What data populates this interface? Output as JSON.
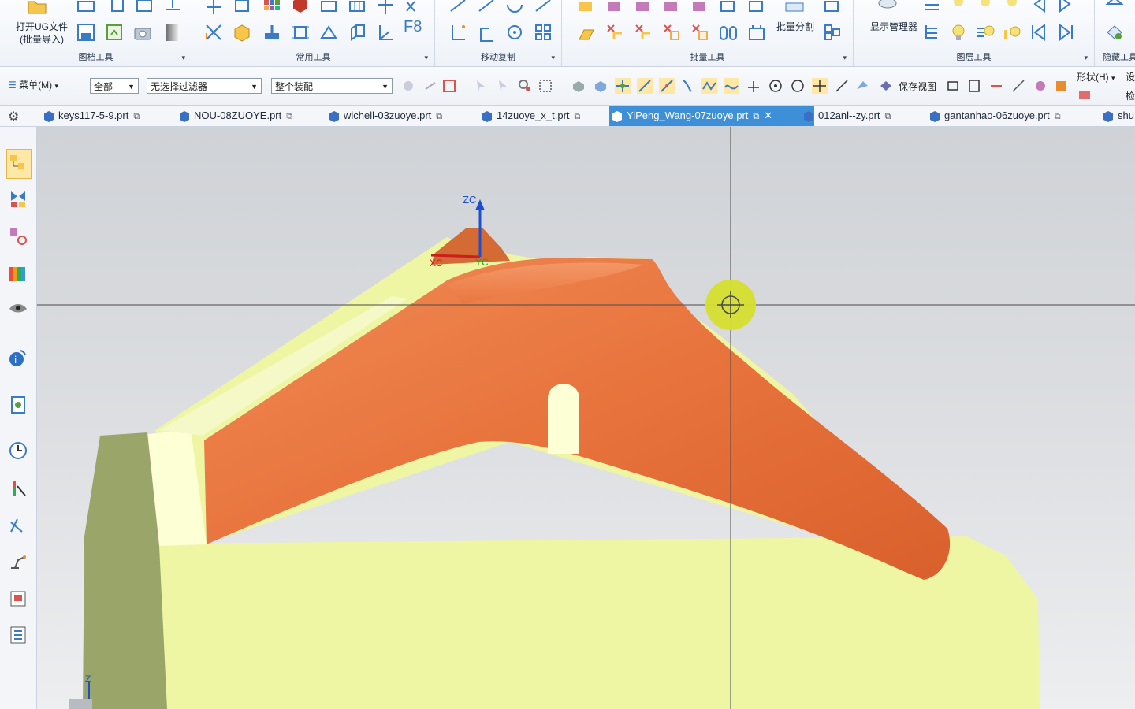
{
  "ribbon": {
    "open_ug": "打开UG文件",
    "batch_import": "(批量导入)",
    "groups": {
      "file_tools": "图档工具",
      "common_tools": "常用工具",
      "move_copy": "移动复制",
      "batch_tools": "批量工具",
      "layer_tools": "图层工具",
      "hide_tools": "隐藏工具"
    },
    "f8_label": "F8",
    "batch_split": "批量分割",
    "display_manager": "显示管理器"
  },
  "toolbar": {
    "menu_label": "菜单(M)",
    "filter_all": "全部",
    "no_filter": "无选择过滤器",
    "whole_assembly": "整个装配",
    "save_view": "保存视图",
    "shape_label": "形状(H)",
    "settings_partial": "设",
    "check_partial": "检"
  },
  "tabs": [
    {
      "label": "keys117-5-9.prt",
      "active": false
    },
    {
      "label": "NOU-08ZUOYE.prt",
      "active": false
    },
    {
      "label": "wichell-03zuoye.prt",
      "active": false
    },
    {
      "label": "14zuoye_x_t.prt",
      "active": false
    },
    {
      "label": "YiPeng_Wang-07zuoye.prt",
      "active": true
    },
    {
      "label": "012anl--zy.prt",
      "active": false
    },
    {
      "label": "gantanhao-06zuoye.prt",
      "active": false
    },
    {
      "label": "shu",
      "active": false
    }
  ],
  "close_glyph": "✕",
  "viewport": {
    "axis_zc": "ZC",
    "axis_xc": "XC",
    "axis_yc": "YC",
    "axis_z": "Z"
  },
  "colors": {
    "model_orange": "#e8733c",
    "model_yellow": "#eef6a4",
    "model_olive": "#9aa56a",
    "active_tab": "#3d8fd8",
    "cursor_ring": "#d6de2e"
  }
}
